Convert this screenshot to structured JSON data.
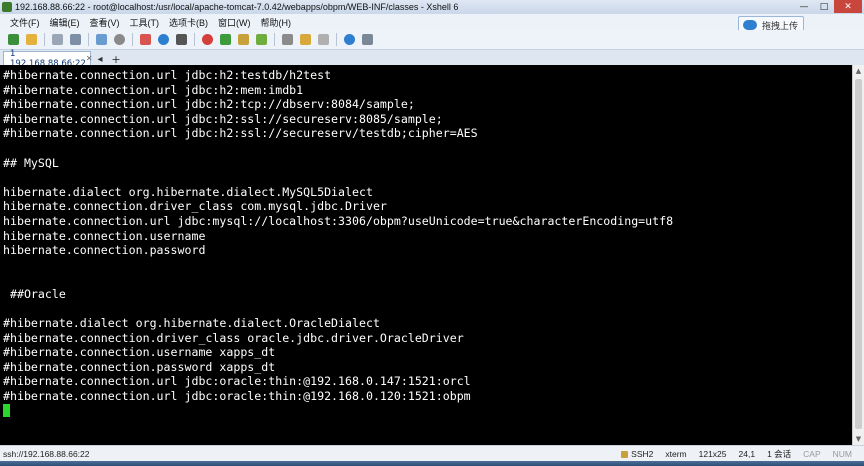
{
  "window": {
    "title": "192.168.88.66:22 - root@localhost:/usr/local/apache-tomcat-7.0.42/webapps/obpm/WEB-INF/classes - Xshell 6",
    "controls": {
      "minimize": "—",
      "maximize": "□",
      "close": "✕"
    }
  },
  "menubar": {
    "items": [
      "文件(F)",
      "编辑(E)",
      "查看(V)",
      "工具(T)",
      "选项卡(B)",
      "窗口(W)",
      "帮助(H)"
    ]
  },
  "upload_button": {
    "label": "拖拽上传"
  },
  "toolbar": {
    "icons": [
      "new-session-icon",
      "open-folder-icon",
      "disconnect-icon",
      "reconnect-icon",
      "properties-icon",
      "find-icon",
      "color-scheme-icon",
      "globe-icon",
      "font-icon",
      "xftp-icon",
      "xmanager-icon",
      "lock-icon",
      "expand-icon",
      "keyboard-icon",
      "compose-icon",
      "layout-icon",
      "help-icon",
      "tools-icon"
    ]
  },
  "tabs": [
    {
      "label": "1 192.168.88.66:22",
      "active": true
    }
  ],
  "terminal": {
    "lines": [
      "#hibernate.connection.url jdbc:h2:testdb/h2test",
      "#hibernate.connection.url jdbc:h2:mem:imdb1",
      "#hibernate.connection.url jdbc:h2:tcp://dbserv:8084/sample;",
      "#hibernate.connection.url jdbc:h2:ssl://secureserv:8085/sample;",
      "#hibernate.connection.url jdbc:h2:ssl://secureserv/testdb;cipher=AES",
      "",
      "## MySQL",
      "",
      "hibernate.dialect org.hibernate.dialect.MySQL5Dialect",
      "hibernate.connection.driver_class com.mysql.jdbc.Driver",
      "hibernate.connection.url jdbc:mysql://localhost:3306/obpm?useUnicode=true&characterEncoding=utf8",
      "hibernate.connection.username",
      "hibernate.connection.password",
      "",
      "",
      " ##Oracle",
      "",
      "#hibernate.dialect org.hibernate.dialect.OracleDialect",
      "#hibernate.connection.driver_class oracle.jdbc.driver.OracleDriver",
      "#hibernate.connection.username xapps_dt",
      "#hibernate.connection.password xapps_dt",
      "#hibernate.connection.url jdbc:oracle:thin:@192.168.0.147:1521:orcl",
      "#hibernate.connection.url jdbc:oracle:thin:@192.168.0.120:1521:obpm"
    ],
    "cursor_color": "#2bd62b"
  },
  "statusbar": {
    "connection": "ssh://192.168.88.66:22",
    "protocol": "SSH2",
    "terminal_type": "xterm",
    "size": "121x25",
    "position": "24,1",
    "sessions": "1 会话",
    "caps": "CAP",
    "num": "NUM"
  }
}
